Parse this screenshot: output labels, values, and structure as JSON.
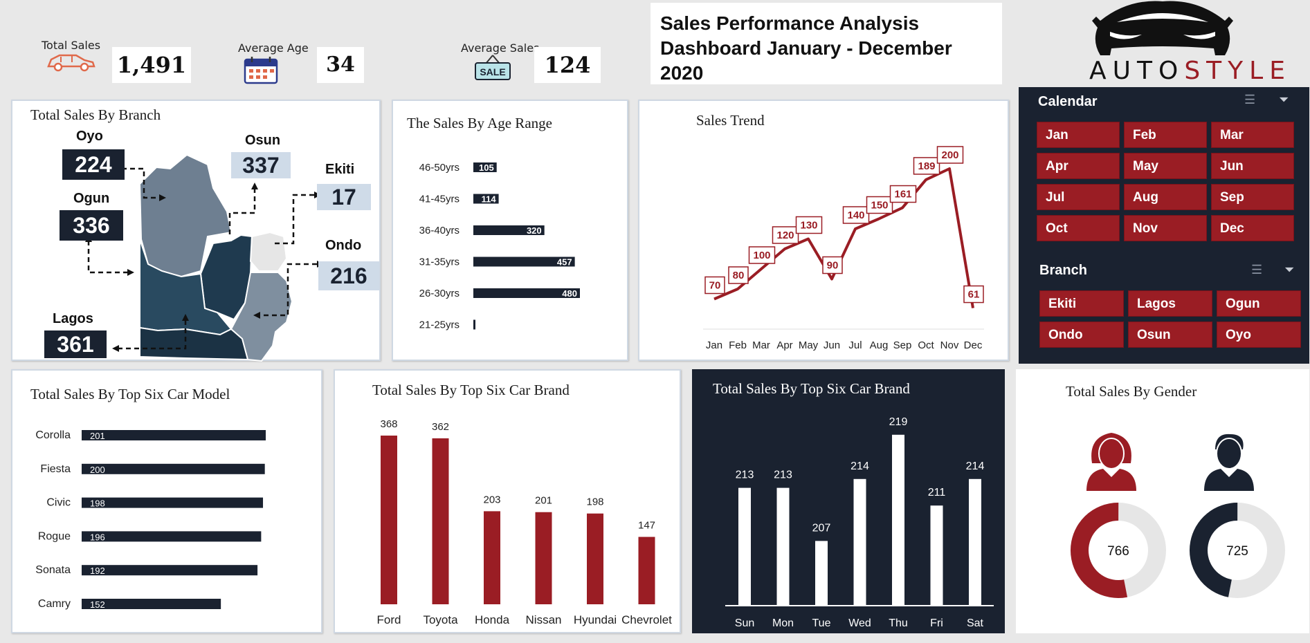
{
  "kpis": {
    "total_sales_label": "Total Sales",
    "total_sales_value": "1,491",
    "average_age_label": "Average Age",
    "average_age_value": "34",
    "average_sales_label": "Average Sales",
    "average_sales_value": "124",
    "sale_tag_text": "SALE"
  },
  "header": {
    "title_line1": "Sales Performance Analysis",
    "title_line2": "Dashboard January - December 2020",
    "logo_auto": "AUTO",
    "logo_style": "STYLE"
  },
  "branch_map": {
    "title": "Total Sales By Branch",
    "branches": [
      {
        "name": "Oyo",
        "value": "224"
      },
      {
        "name": "Osun",
        "value": "337"
      },
      {
        "name": "Ekiti",
        "value": "17"
      },
      {
        "name": "Ogun",
        "value": "336"
      },
      {
        "name": "Ondo",
        "value": "216"
      },
      {
        "name": "Lagos",
        "value": "361"
      }
    ]
  },
  "slicers": {
    "calendar_title": "Calendar",
    "months": [
      "Jan",
      "Feb",
      "Mar",
      "Apr",
      "May",
      "Jun",
      "Jul",
      "Aug",
      "Sep",
      "Oct",
      "Nov",
      "Dec"
    ],
    "branch_title": "Branch",
    "branches": [
      "Ekiti",
      "Lagos",
      "Ogun",
      "Ondo",
      "Osun",
      "Oyo"
    ]
  },
  "colors": {
    "accent": "#9a1d24",
    "navy": "#1a2230",
    "light_blue": "#cfdbe8"
  },
  "icons": [
    "car-icon",
    "calendar-icon",
    "sale-tag-icon",
    "car-logo-icon",
    "multi-select-icon",
    "clear-filter-icon",
    "female-user-icon",
    "male-user-icon"
  ],
  "chart_data": [
    {
      "id": "age",
      "type": "bar",
      "orientation": "horizontal",
      "title": "The Sales By Age Range",
      "categories": [
        "46-50yrs",
        "41-45yrs",
        "36-40yrs",
        "31-35yrs",
        "26-30yrs",
        "21-25yrs"
      ],
      "values": [
        105,
        114,
        320,
        457,
        480,
        5
      ],
      "data_labels": [
        "105",
        "114",
        "320",
        "457",
        "480",
        ""
      ],
      "xlim": [
        0,
        480
      ]
    },
    {
      "id": "trend",
      "type": "line",
      "title": "Sales Trend",
      "categories": [
        "Jan",
        "Feb",
        "Mar",
        "Apr",
        "May",
        "Jun",
        "Jul",
        "Aug",
        "Sep",
        "Oct",
        "Nov",
        "Dec"
      ],
      "values": [
        70,
        80,
        100,
        120,
        130,
        90,
        140,
        150,
        161,
        189,
        200,
        61
      ],
      "ylim": [
        40,
        240
      ]
    },
    {
      "id": "model",
      "type": "bar",
      "orientation": "horizontal",
      "title": "Total Sales By Top Six Car Model",
      "categories": [
        "Corolla",
        "Fiesta",
        "Civic",
        "Rogue",
        "Sonata",
        "Camry"
      ],
      "values": [
        201,
        200,
        198,
        196,
        192,
        152
      ],
      "xlim": [
        0,
        201
      ]
    },
    {
      "id": "brand",
      "type": "bar",
      "title": "Total Sales By Top Six Car Brand",
      "categories": [
        "Ford",
        "Toyota",
        "Honda",
        "Nissan",
        "Hyundai",
        "Chevrolet"
      ],
      "values": [
        368,
        362,
        203,
        201,
        198,
        147
      ],
      "ylim": [
        0,
        368
      ]
    },
    {
      "id": "weekday",
      "type": "bar",
      "title": "Total Sales By Top Six Car Brand",
      "categories": [
        "Sun",
        "Mon",
        "Tue",
        "Wed",
        "Thu",
        "Fri",
        "Sat"
      ],
      "values": [
        213,
        213,
        207,
        214,
        219,
        211,
        214
      ],
      "ylim": [
        200,
        220
      ]
    },
    {
      "id": "gender",
      "type": "pie",
      "title": "Total Sales By Gender",
      "series": [
        {
          "values": [
            766,
            725
          ]
        }
      ],
      "labels": [
        "766",
        "725"
      ],
      "total": 1491
    }
  ]
}
